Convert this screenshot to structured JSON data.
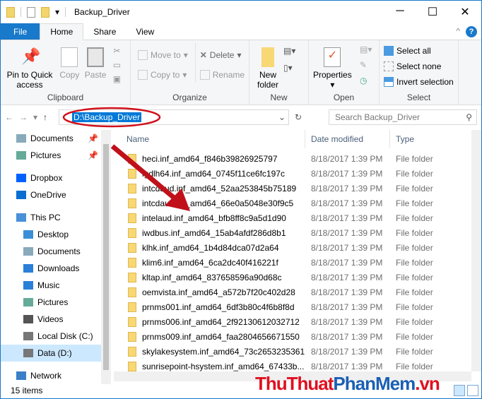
{
  "window": {
    "title": "Backup_Driver",
    "minimize": "─",
    "maximize": "☐",
    "close": "✕"
  },
  "tabs": [
    {
      "label": "File"
    },
    {
      "label": "Home"
    },
    {
      "label": "Share"
    },
    {
      "label": "View"
    }
  ],
  "ribbon": {
    "clipboard": {
      "label": "Clipboard",
      "pin": "Pin to Quick access",
      "copy": "Copy",
      "paste": "Paste"
    },
    "organize": {
      "label": "Organize",
      "move_to": "Move to",
      "copy_to": "Copy to",
      "delete": "Delete",
      "rename": "Rename"
    },
    "new": {
      "label": "New",
      "new_folder": "New folder"
    },
    "open": {
      "label": "Open",
      "properties": "Properties"
    },
    "select": {
      "label": "Select",
      "select_all": "Select all",
      "select_none": "Select none",
      "invert": "Invert selection"
    }
  },
  "address": {
    "path": "D:\\Backup_Driver",
    "search_placeholder": "Search Backup_Driver"
  },
  "nav": [
    {
      "label": "Documents",
      "icon": "documents-icon",
      "pinned": true
    },
    {
      "label": "Pictures",
      "icon": "pictures-icon",
      "pinned": true
    },
    {
      "label": "Dropbox",
      "icon": "dropbox-icon"
    },
    {
      "label": "OneDrive",
      "icon": "onedrive-icon"
    },
    {
      "label": "This PC",
      "icon": "pc-icon"
    },
    {
      "label": "Desktop",
      "icon": "desktop-icon"
    },
    {
      "label": "Documents",
      "icon": "documents-icon"
    },
    {
      "label": "Downloads",
      "icon": "downloads-icon"
    },
    {
      "label": "Music",
      "icon": "music-icon"
    },
    {
      "label": "Pictures",
      "icon": "pictures-icon"
    },
    {
      "label": "Videos",
      "icon": "videos-icon"
    },
    {
      "label": "Local Disk (C:)",
      "icon": "drive-icon"
    },
    {
      "label": "Data (D:)",
      "icon": "drive-icon",
      "selected": true
    },
    {
      "label": "Network",
      "icon": "network-icon"
    }
  ],
  "columns": {
    "name": "Name",
    "date": "Date modified",
    "type": "Type"
  },
  "files": [
    {
      "name": "heci.inf_amd64_f846b39826925797",
      "date": "8/18/2017 1:39 PM",
      "type": "File folder"
    },
    {
      "name": "igdlh64.inf_amd64_0745f11ce6fc197c",
      "date": "8/18/2017 1:39 PM",
      "type": "File folder"
    },
    {
      "name": "intcdaud.inf_amd64_52aa253845b75189",
      "date": "8/18/2017 1:39 PM",
      "type": "File folder"
    },
    {
      "name": "intcdaud.inf_amd64_66e0a5048e30f9c5",
      "date": "8/18/2017 1:39 PM",
      "type": "File folder"
    },
    {
      "name": "intelaud.inf_amd64_bfb8ff8c9a5d1d90",
      "date": "8/18/2017 1:39 PM",
      "type": "File folder"
    },
    {
      "name": "iwdbus.inf_amd64_15ab4afdf286d8b1",
      "date": "8/18/2017 1:39 PM",
      "type": "File folder"
    },
    {
      "name": "klhk.inf_amd64_1b4d84dca07d2a64",
      "date": "8/18/2017 1:39 PM",
      "type": "File folder"
    },
    {
      "name": "klim6.inf_amd64_6ca2dc40f416221f",
      "date": "8/18/2017 1:39 PM",
      "type": "File folder"
    },
    {
      "name": "kltap.inf_amd64_837658596a90d68c",
      "date": "8/18/2017 1:39 PM",
      "type": "File folder"
    },
    {
      "name": "oemvista.inf_amd64_a572b7f20c402d28",
      "date": "8/18/2017 1:39 PM",
      "type": "File folder"
    },
    {
      "name": "prnms001.inf_amd64_6df3b80c4f6b8f8d",
      "date": "8/18/2017 1:39 PM",
      "type": "File folder"
    },
    {
      "name": "prnms006.inf_amd64_2f92130612032712",
      "date": "8/18/2017 1:39 PM",
      "type": "File folder"
    },
    {
      "name": "prnms009.inf_amd64_faa2804656671550",
      "date": "8/18/2017 1:39 PM",
      "type": "File folder"
    },
    {
      "name": "skylakesystem.inf_amd64_73c2653235361...",
      "date": "8/18/2017 1:39 PM",
      "type": "File folder"
    },
    {
      "name": "sunrisepoint-hsystem.inf_amd64_67433b...",
      "date": "8/18/2017 1:39 PM",
      "type": "File folder"
    }
  ],
  "status": {
    "count": "15 items"
  },
  "watermark": {
    "part1": "ThuThuat",
    "part2": "PhanMem",
    "part3": ".vn"
  },
  "colors": {
    "accent": "#1979ca",
    "annotation": "#d0101a"
  }
}
